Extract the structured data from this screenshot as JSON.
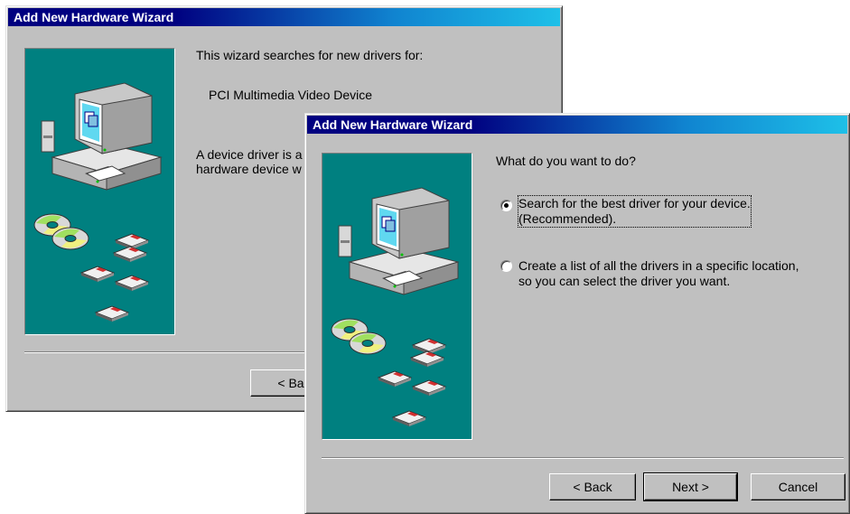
{
  "back_window": {
    "title": "Add New Hardware Wizard",
    "intro": "This wizard searches for new drivers for:",
    "device_name": "PCI Multimedia Video Device",
    "driver_text_line1": "A device driver is a",
    "driver_text_line2": "hardware device w",
    "back_button": "< Ba"
  },
  "front_window": {
    "title": "Add New Hardware Wizard",
    "question": "What do you want to do?",
    "options": [
      {
        "line1": "Search for the best driver for your device.",
        "line2": "(Recommended).",
        "selected": true
      },
      {
        "line1": "Create a list of all the drivers in a specific location,",
        "line2": "so you can select the driver you want.",
        "selected": false
      }
    ],
    "buttons": {
      "back": "< Back",
      "next": "Next >",
      "cancel": "Cancel"
    }
  },
  "icons": [
    "computer-icon",
    "cd-icon",
    "floppy-disk-icon"
  ],
  "colors": {
    "title_bar": "#000080",
    "panel_bg": "#008080",
    "window_bg": "#c0c0c0"
  }
}
